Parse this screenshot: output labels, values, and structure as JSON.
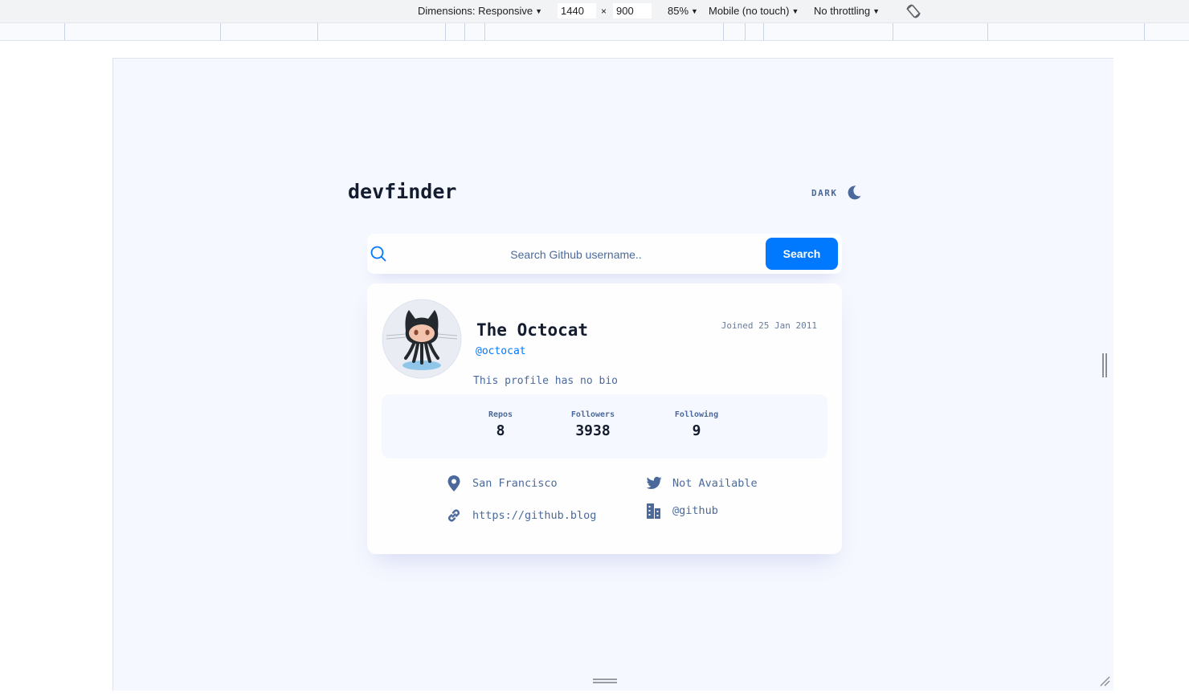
{
  "devtools": {
    "dimensions_label": "Dimensions: Responsive",
    "width": "1440",
    "times": "×",
    "height": "900",
    "zoom": "85%",
    "device_mode": "Mobile (no touch)",
    "throttling": "No throttling"
  },
  "app": {
    "logo": "devfinder",
    "theme_toggle_label": "DARK",
    "search": {
      "placeholder": "Search Github username..",
      "button_label": "Search"
    },
    "profile": {
      "name": "The Octocat",
      "login": "@octocat",
      "joined": "Joined 25 Jan 2011",
      "bio": "This profile has no bio",
      "stats": [
        {
          "label": "Repos",
          "value": "8"
        },
        {
          "label": "Followers",
          "value": "3938"
        },
        {
          "label": "Following",
          "value": "9"
        }
      ],
      "location": "San Francisco",
      "blog": "https://github.blog",
      "twitter": "Not Available",
      "company": "@github"
    }
  },
  "colors": {
    "accent": "#0079ff",
    "text_muted": "#4b6a9b",
    "text_dark": "#141d2f",
    "page_bg": "#f6f8ff",
    "card_bg": "#fefefe"
  }
}
